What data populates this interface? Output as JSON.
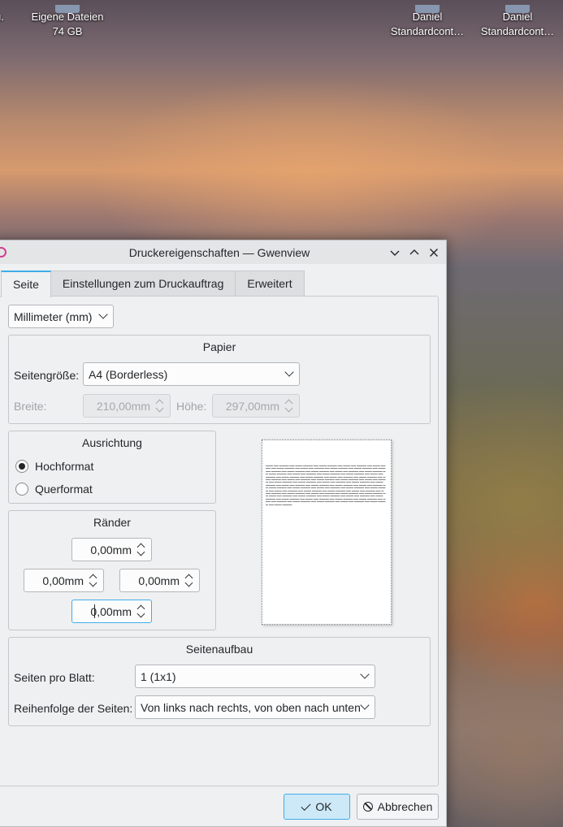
{
  "desktop": {
    "icons": [
      {
        "line1": "u.",
        "line2": ""
      },
      {
        "line1": "Eigene Dateien",
        "line2": "74 GB"
      },
      {
        "line1": "Daniel",
        "line2": "Standardcont…"
      },
      {
        "line1": "Daniel",
        "line2": "Standardcont…"
      }
    ]
  },
  "dialog": {
    "title": "Druckereigenschaften — Gwenview",
    "tabs": [
      "Seite",
      "Einstellungen zum Druckauftrag",
      "Erweitert"
    ],
    "active_tab": "Seite",
    "unit": "Millimeter (mm)",
    "paper": {
      "title": "Papier",
      "page_size_label": "Seitengröße:",
      "page_size_value": "A4 (Borderless)",
      "width_label": "Breite:",
      "width_value": "210,00mm",
      "height_label": "Höhe:",
      "height_value": "297,00mm"
    },
    "orientation": {
      "title": "Ausrichtung",
      "portrait": "Hochformat",
      "landscape": "Querformat",
      "selected": "Hochformat"
    },
    "margins": {
      "title": "Ränder",
      "top": "0,00mm",
      "left": "0,00mm",
      "right": "0,00mm",
      "bottom": "0,00mm"
    },
    "layout": {
      "title": "Seitenaufbau",
      "pages_per_sheet_label": "Seiten pro Blatt:",
      "pages_per_sheet_value": "1 (1x1)",
      "page_order_label": "Reihenfolge der Seiten:",
      "page_order_value": "Von links nach rechts, von oben nach unten"
    },
    "buttons": {
      "ok": "OK",
      "cancel": "Abbrechen"
    }
  },
  "colors": {
    "accent": "#3daee9",
    "window_bg": "#eff0f1"
  }
}
